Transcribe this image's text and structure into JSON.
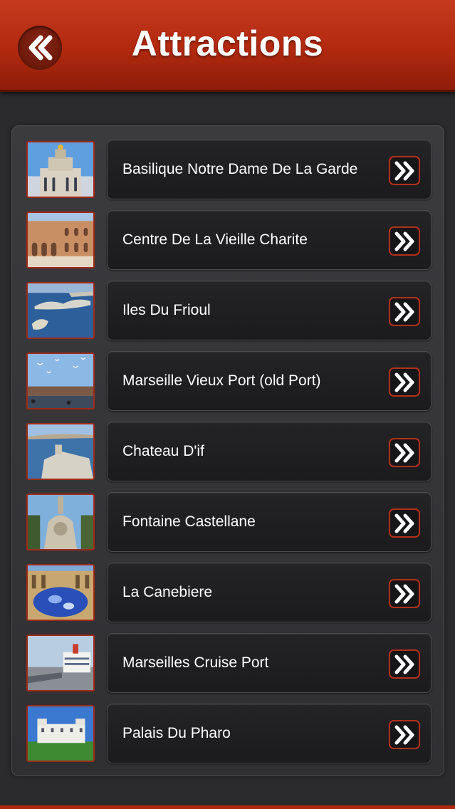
{
  "header": {
    "title": "Attractions",
    "back_icon": "double-chevron-left-icon",
    "color": "#b2290f"
  },
  "list": {
    "arrow_icon": "double-chevron-right-icon",
    "items": [
      {
        "label": "Basilique Notre Dame De La Garde"
      },
      {
        "label": "Centre De La Vieille Charite"
      },
      {
        "label": "Iles Du Frioul"
      },
      {
        "label": "Marseille Vieux Port (old Port)"
      },
      {
        "label": "Chateau D'if"
      },
      {
        "label": "Fontaine Castellane"
      },
      {
        "label": "La Canebiere"
      },
      {
        "label": "Marseilles Cruise Port"
      },
      {
        "label": "Palais Du Pharo"
      }
    ]
  }
}
